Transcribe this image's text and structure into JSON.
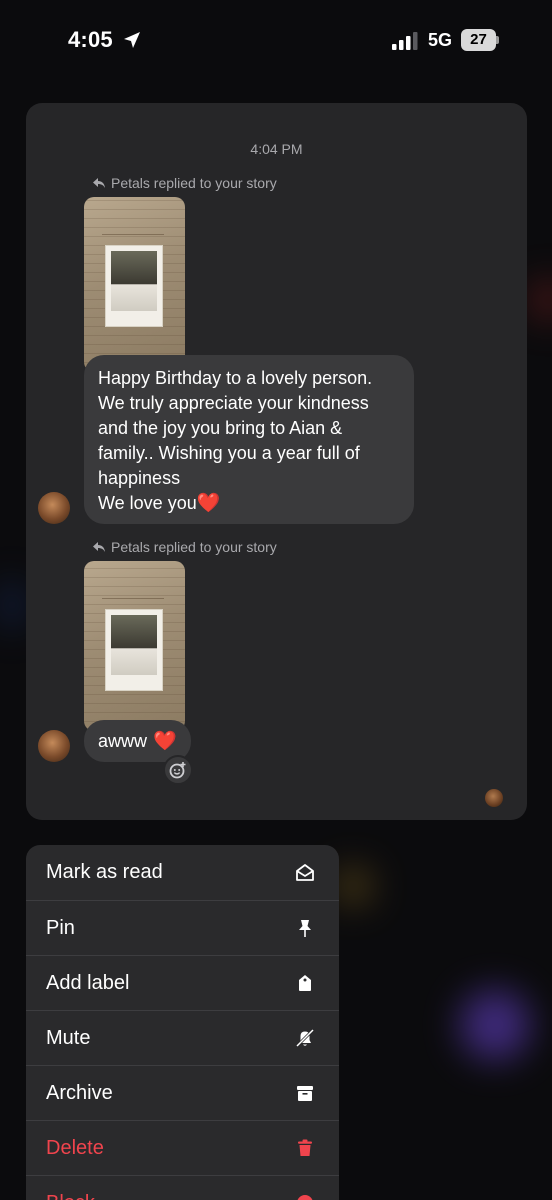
{
  "status_bar": {
    "time": "4:05",
    "network": "5G",
    "battery": "27"
  },
  "chat": {
    "timestamp": "4:04 PM",
    "messages": [
      {
        "reply_label": "Petals replied to your story",
        "text": "Happy Birthday to a lovely person.\nWe truly appreciate your kindness and the joy you bring to Aian & family.. Wishing you a year full of happiness\nWe love you"
      },
      {
        "reply_label": "Petals replied to your story",
        "text": "awww"
      }
    ],
    "heart": "❤️"
  },
  "menu": {
    "items": [
      {
        "label": "Mark as read",
        "icon": "envelope-open-icon"
      },
      {
        "label": "Pin",
        "icon": "pin-icon"
      },
      {
        "label": "Add label",
        "icon": "tag-icon"
      },
      {
        "label": "Mute",
        "icon": "bell-slash-icon"
      },
      {
        "label": "Archive",
        "icon": "archive-icon"
      },
      {
        "label": "Delete",
        "icon": "trash-icon",
        "color": "#f0444d"
      },
      {
        "label": "Block",
        "icon": "block-icon",
        "color": "#f0444d"
      }
    ]
  }
}
